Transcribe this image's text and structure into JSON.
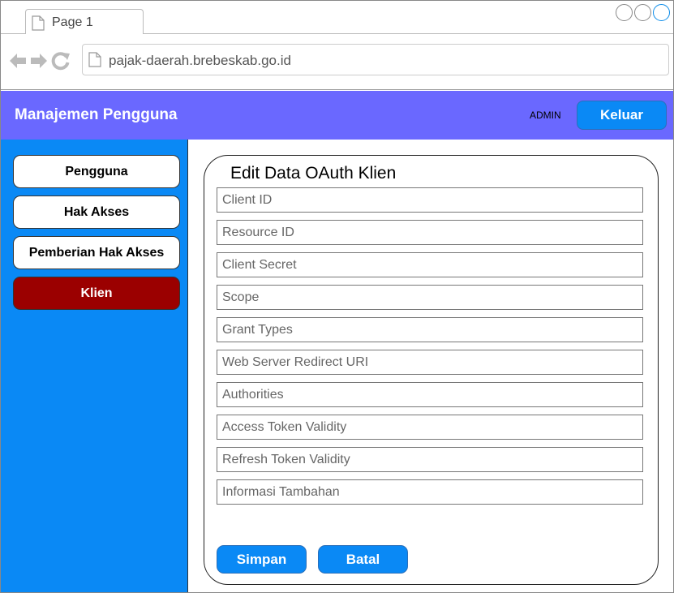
{
  "browser": {
    "tab_label": "Page 1",
    "url": "pajak-daerah.brebeskab.go.id"
  },
  "header": {
    "title": "Manajemen Pengguna",
    "user": "ADMIN",
    "logout_label": "Keluar"
  },
  "sidebar": {
    "items": [
      {
        "label": "Pengguna"
      },
      {
        "label": "Hak Akses"
      },
      {
        "label": "Pemberian Hak Akses"
      },
      {
        "label": "Klien"
      }
    ]
  },
  "form": {
    "title": "Edit Data OAuth Klien",
    "fields": [
      {
        "placeholder": "Client ID"
      },
      {
        "placeholder": "Resource ID"
      },
      {
        "placeholder": "Client Secret"
      },
      {
        "placeholder": "Scope"
      },
      {
        "placeholder": "Grant Types"
      },
      {
        "placeholder": "Web Server Redirect URI"
      },
      {
        "placeholder": "Authorities"
      },
      {
        "placeholder": "Access Token Validity"
      },
      {
        "placeholder": "Refresh Token Validity"
      },
      {
        "placeholder": "Informasi Tambahan"
      }
    ],
    "save_label": "Simpan",
    "cancel_label": "Batal"
  },
  "colors": {
    "header_bg": "#6a68ff",
    "sidebar_bg": "#0a89f5",
    "active_item": "#9b0000",
    "button": "#0a89f5"
  }
}
